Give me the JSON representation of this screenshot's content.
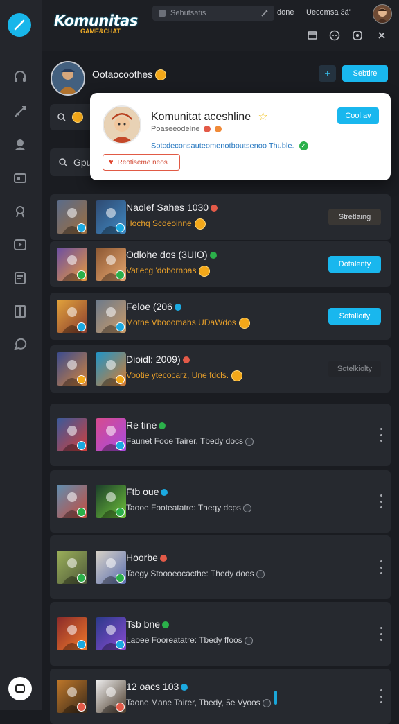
{
  "app": {
    "title": "Komunitas",
    "subtitle": "GAME&CHAT"
  },
  "topbar": {
    "search_label": "Sebutsatis",
    "done_label": "done",
    "user_label": "Uecomsa 3ä'"
  },
  "profile": {
    "name": "Ootaocoothes",
    "cta_label": "Sebtire"
  },
  "behind": {
    "search_text": "Gpu"
  },
  "popover": {
    "title": "Komunitat aceshline",
    "subtitle": "Poaseeodelne",
    "description": "Sotcdeconsauteomenotboutsenoo Thuble.",
    "button_label": "Cool av",
    "tag_label": "Reotiseme neos"
  },
  "cards": [
    {
      "title": "Naolef Sahes 1030",
      "subtitle": "Hochq Scdeoinne",
      "action": "Stretlaing",
      "style": "dark"
    },
    {
      "title": "Odlohe dos (3UIO)",
      "subtitle": "Vatlecg 'dobornpas",
      "action": "Dotalenty",
      "style": "blue"
    },
    {
      "title": "Feloe (206",
      "subtitle": "Motne Vbooomahs UDaWdos",
      "action": "Sotalloity",
      "style": "blue"
    },
    {
      "title": "Dioidl: 2009)",
      "subtitle": "Vootie ytecocarz, Une fdcls.",
      "action": "Sotelkiolty",
      "style": "darker"
    },
    {
      "title": "Re tine",
      "subtitle": "Faunet Fooe Tairer, Tbedy docs",
      "action": "",
      "style": "kebab"
    },
    {
      "title": "Ftb oue",
      "subtitle": "Taooe Footeatatre: Theqy dcps",
      "action": "",
      "style": "kebab"
    },
    {
      "title": "Hoorbe",
      "subtitle": "Taegy Stoooeocacthe: Thedy doos",
      "action": "",
      "style": "kebab"
    },
    {
      "title": "Tsb bne",
      "subtitle": "Laoee Fooreatatre: Tbedy ffoos",
      "action": "",
      "style": "kebab"
    },
    {
      "title": "12 oacs 103",
      "subtitle": "Taone Mane Tairer, Tbedy, 5e Vyoos",
      "action": "",
      "style": "kebab"
    }
  ],
  "colors": {
    "accent": "#19b7ee",
    "coin": "#f3a81a",
    "background": "#1a1c21",
    "card": "#26292f"
  },
  "icons": {
    "sidebar": [
      "headset-icon",
      "sword-icon",
      "profile-icon",
      "id-card-icon",
      "ribbon-icon",
      "play-icon",
      "note-icon",
      "book-icon",
      "chat-icon"
    ]
  }
}
